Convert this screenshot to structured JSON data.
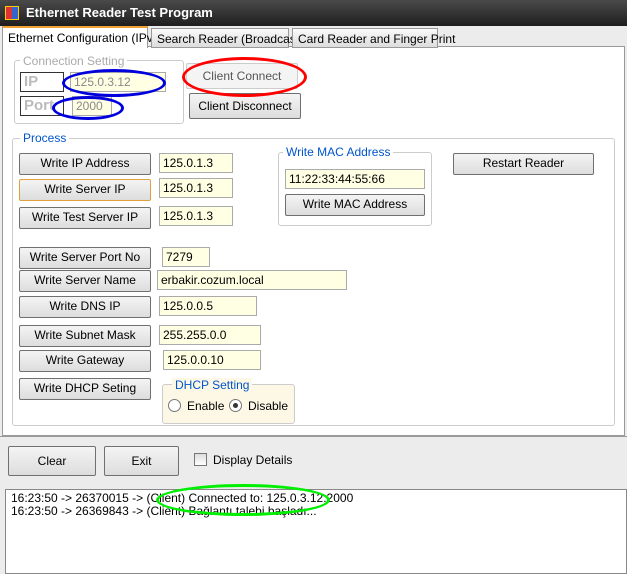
{
  "window": {
    "title": "Ethernet Reader Test Program"
  },
  "tabs": [
    {
      "label": "Ethernet Configuration (IPv4)",
      "active": true
    },
    {
      "label": "Search Reader (Broadcast)"
    },
    {
      "label": "Card Reader and Finger Print"
    }
  ],
  "connection": {
    "group_label": "Connection Setting",
    "ip_label": "IP",
    "ip_value": "125.0.3.12",
    "port_label": "Port",
    "port_value": "2000",
    "connect_label": "Client Connect",
    "disconnect_label": "Client Disconnect"
  },
  "process": {
    "group_label": "Process",
    "rows": [
      {
        "button": "Write IP Address",
        "value": "125.0.1.3"
      },
      {
        "button": "Write Server IP",
        "value": "125.0.1.3"
      },
      {
        "button": "Write Test Server IP",
        "value": "125.0.1.3"
      },
      {
        "button": "Write Server Port No",
        "value": "7279"
      },
      {
        "button": "Write Server Name",
        "value": "erbakir.cozum.local"
      },
      {
        "button": "Write DNS IP",
        "value": "125.0.0.5"
      },
      {
        "button": "Write Subnet Mask",
        "value": "255.255.0.0"
      },
      {
        "button": "Write Gateway",
        "value": "125.0.0.10"
      }
    ],
    "dhcp_button": "Write DHCP Seting",
    "mac_group": "Write MAC Address",
    "mac_value": "11:22:33:44:55:66",
    "mac_button": "Write MAC Address",
    "restart": "Restart Reader",
    "dhcp_group": "DHCP Setting",
    "enable": "Enable",
    "disable": "Disable",
    "dhcp_selected": "Disable"
  },
  "bottom": {
    "clear": "Clear",
    "exit": "Exit",
    "display_details": "Display Details",
    "display_details_checked": false
  },
  "log": [
    "16:23:50 -> 26370015 -> (Client) Connected to: 125.0.3.12:2000",
    "16:23:50 -> 26369843 -> (Client) Bağlantı talebi başladı..."
  ],
  "annotation_colors": {
    "ip_port": "#0000dd",
    "connect": "#ff0000",
    "log": "#00ee00"
  }
}
